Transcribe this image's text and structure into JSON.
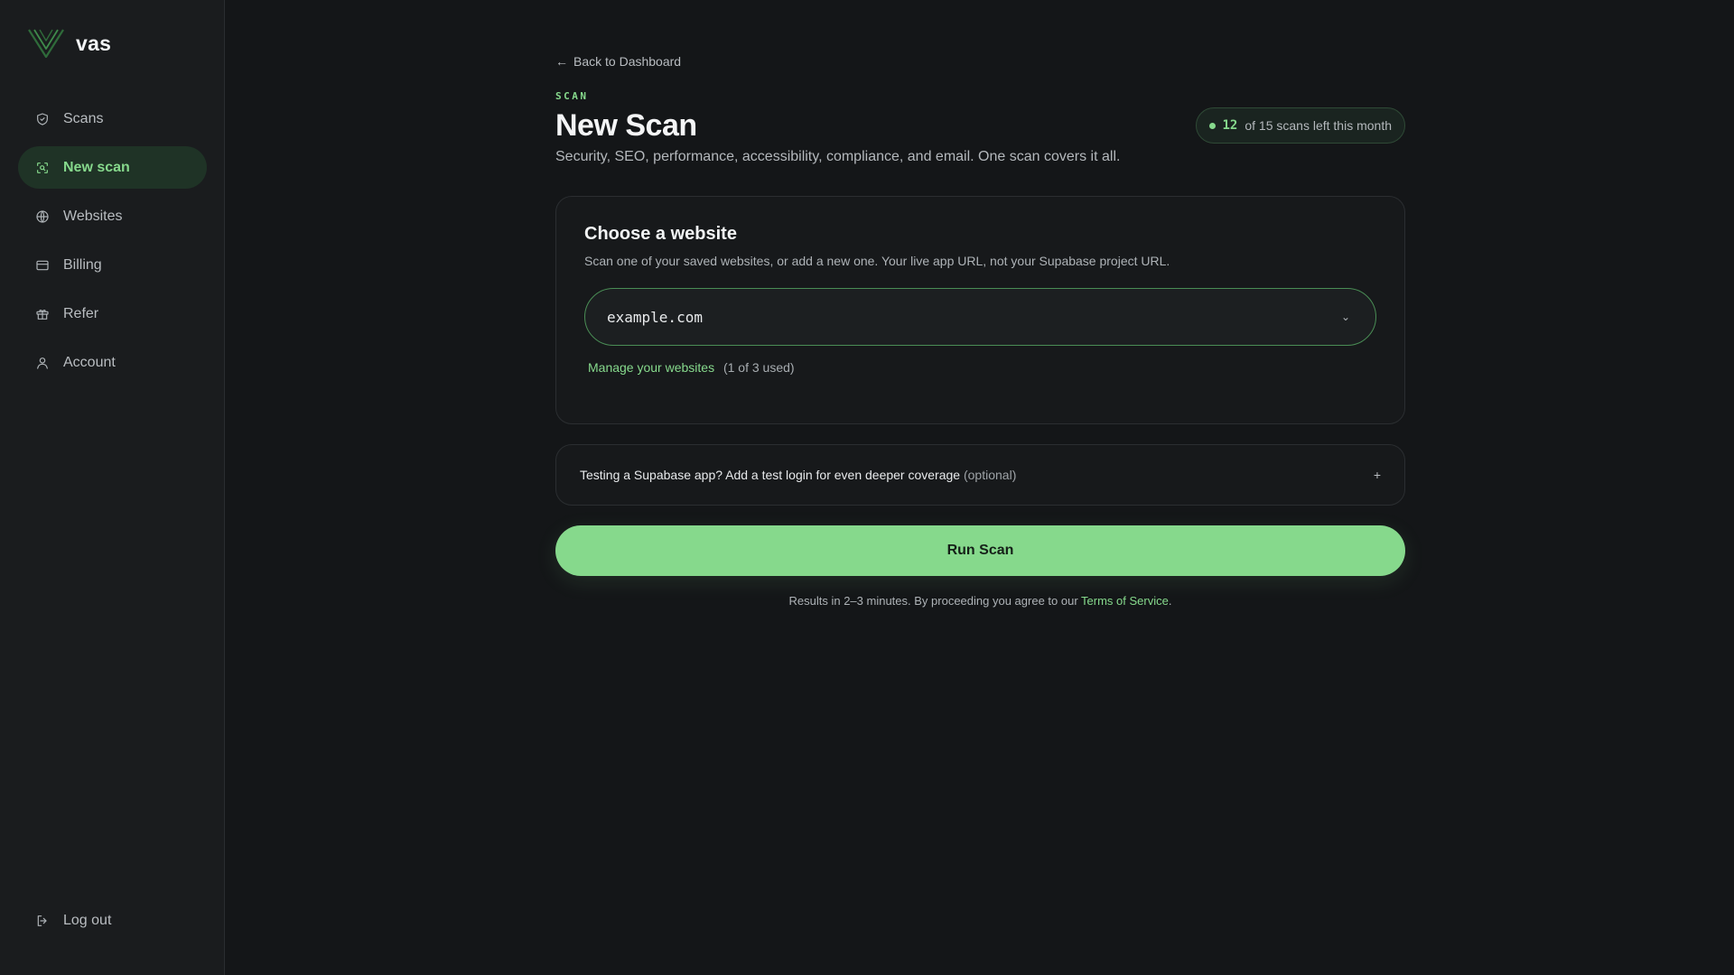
{
  "brand": {
    "name": "vas"
  },
  "sidebar": {
    "items": [
      {
        "label": "Scans",
        "icon": "shield-icon",
        "active": false
      },
      {
        "label": "New scan",
        "icon": "scan-icon",
        "active": true
      },
      {
        "label": "Websites",
        "icon": "globe-icon",
        "active": false
      },
      {
        "label": "Billing",
        "icon": "card-icon",
        "active": false
      },
      {
        "label": "Refer",
        "icon": "gift-icon",
        "active": false
      },
      {
        "label": "Account",
        "icon": "user-icon",
        "active": false
      }
    ],
    "logout_label": "Log out"
  },
  "header": {
    "back_label": "Back to Dashboard",
    "eyebrow": "SCAN",
    "title": "New Scan",
    "subtitle": "Security, SEO, performance, accessibility, compliance, and email. One scan covers it all.",
    "quota": {
      "remaining": "12",
      "text": "of 15 scans left this month"
    }
  },
  "website_card": {
    "title": "Choose a website",
    "description": "Scan one of your saved websites, or add a new one. Your live app URL, not your Supabase project URL.",
    "selected": "example.com",
    "manage_label": "Manage your websites",
    "manage_count": "(1 of 3 used)"
  },
  "login_card": {
    "text": "Testing a Supabase app? Add a test login for even deeper coverage",
    "optional": "(optional)"
  },
  "run_button_label": "Run Scan",
  "footnote": {
    "text": "Results in 2–3 minutes. By proceeding you agree to our",
    "link": "Terms of Service",
    "end": "."
  },
  "colors": {
    "accent": "#86d98c",
    "background": "#141618",
    "sidebar": "#1a1c1e",
    "active_nav_bg": "#1f3326"
  }
}
